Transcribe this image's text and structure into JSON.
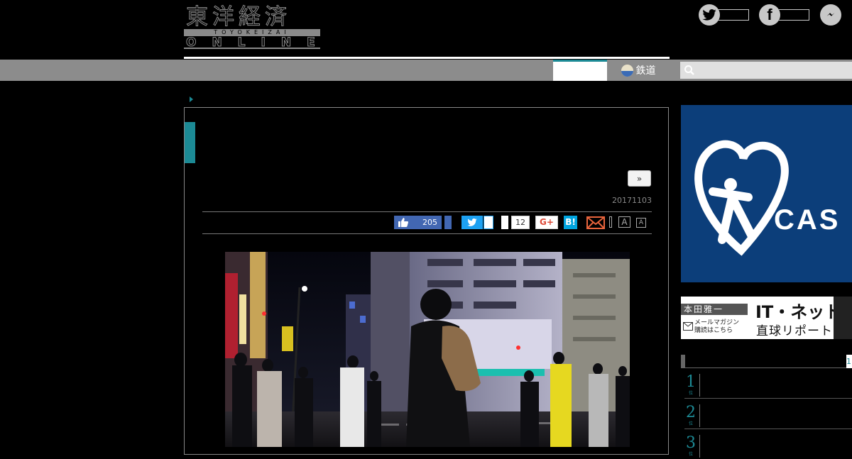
{
  "header": {
    "logo_kanji": "東洋経済",
    "logo_band": "TOYOKEIZAI",
    "logo_online": "ONLINE"
  },
  "social": [
    {
      "name": "twitter-icon",
      "glyph": "t"
    },
    {
      "name": "facebook-icon",
      "glyph": "f"
    },
    {
      "name": "messenger-icon",
      "glyph": "m"
    }
  ],
  "nav": {
    "rail_label": "鉄道",
    "search_placeholder": ""
  },
  "article": {
    "next_label": "»",
    "date": "20171103",
    "share": {
      "like_count": "205",
      "comment_count": "12",
      "gplus_label": "G+",
      "hatena_label": "B!",
      "font_large_label": "A",
      "font_small_label": "A"
    }
  },
  "sidebar": {
    "ad_cas_text": "CAS",
    "ad_it": {
      "author": "本田雅一",
      "mail_label": "メールマガジン",
      "mail_sub": "購読はこちら",
      "title_1": "IT・ネット",
      "title_2": "直球リポート"
    },
    "ranking_tab": "1",
    "ranking": [
      {
        "num": "1",
        "unit": "位"
      },
      {
        "num": "2",
        "unit": "位"
      },
      {
        "num": "3",
        "unit": "位"
      }
    ]
  }
}
